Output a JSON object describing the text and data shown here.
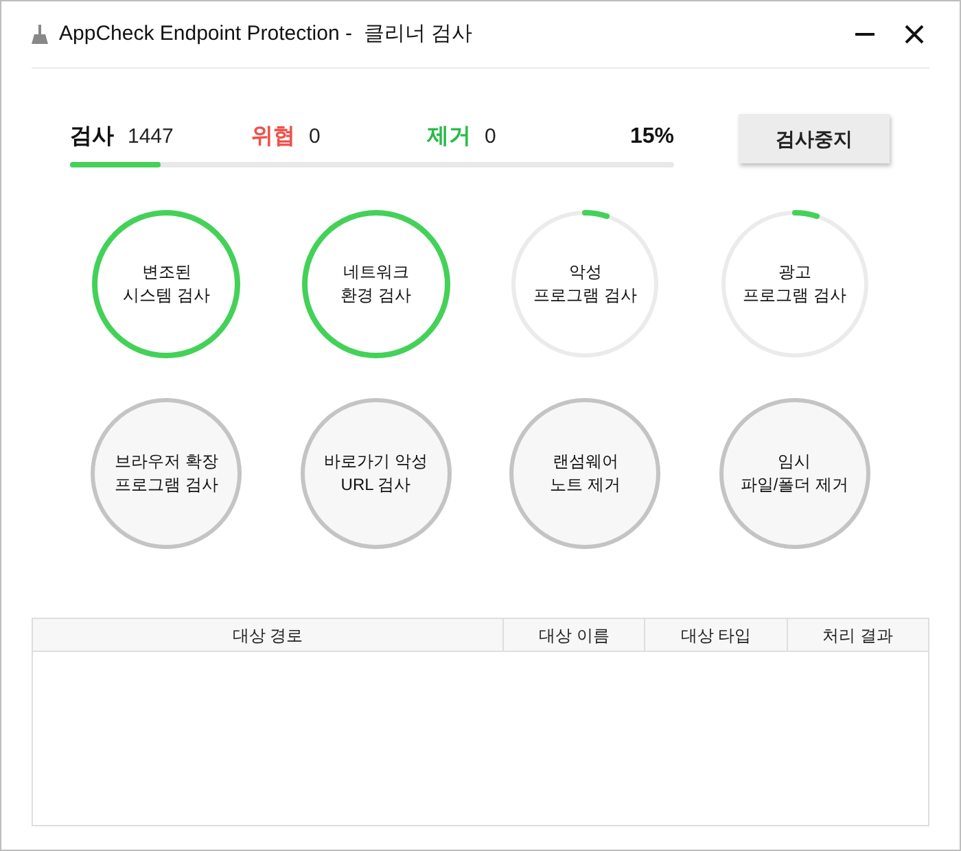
{
  "window": {
    "title": "AppCheck Endpoint Protection -  클리너 검사"
  },
  "stats": {
    "scanned_label": "검사",
    "scanned": "1447",
    "threat_label": "위협",
    "threats": "0",
    "removed_label": "제거",
    "removed": "0",
    "percent": "15%",
    "level": 0.15
  },
  "stop_button": "검사중지",
  "scans": [
    {
      "lines": [
        "변조된",
        "시스템 검사"
      ],
      "kind": "active",
      "level": 1
    },
    {
      "lines": [
        "네트워크",
        "환경 검사"
      ],
      "kind": "active",
      "level": 1
    },
    {
      "lines": [
        "악성",
        "프로그램 검사"
      ],
      "kind": "active",
      "level": 0.05
    },
    {
      "lines": [
        "광고",
        "프로그램 검사"
      ],
      "kind": "active",
      "level": 0.05
    },
    {
      "lines": [
        "브라우저 확장",
        "프로그램 검사"
      ],
      "kind": "pending"
    },
    {
      "lines": [
        "바로가기 악성",
        "URL 검사"
      ],
      "kind": "pending"
    },
    {
      "lines": [
        "랜섬웨어",
        "노트 제거"
      ],
      "kind": "pending"
    },
    {
      "lines": [
        "임시",
        "파일/폴더 제거"
      ],
      "kind": "pending"
    }
  ],
  "table": {
    "columns": [
      "대상 경로",
      "대상 이름",
      "대상 타입",
      "처리 결과"
    ]
  }
}
